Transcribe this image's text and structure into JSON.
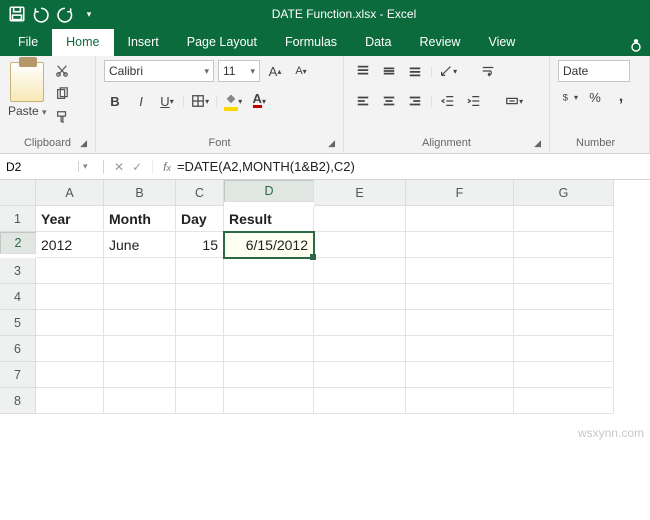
{
  "titlebar": {
    "filename": "DATE Function.xlsx - Excel"
  },
  "tabs": {
    "file": "File",
    "items": [
      "Home",
      "Insert",
      "Page Layout",
      "Formulas",
      "Data",
      "Review",
      "View"
    ],
    "activeIndex": 0
  },
  "ribbon": {
    "clipboard": {
      "paste": "Paste",
      "label": "Clipboard"
    },
    "font": {
      "name": "Calibri",
      "size": "11",
      "label": "Font"
    },
    "alignment": {
      "label": "Alignment"
    },
    "number": {
      "format": "Date",
      "label": "Number"
    }
  },
  "namebox": "D2",
  "formula": "=DATE(A2,MONTH(1&B2),C2)",
  "columns": [
    "A",
    "B",
    "C",
    "D",
    "E",
    "F",
    "G"
  ],
  "rows": [
    "1",
    "2",
    "3",
    "4",
    "5",
    "6",
    "7",
    "8"
  ],
  "headers": {
    "a1": "Year",
    "b1": "Month",
    "c1": "Day",
    "d1": "Result"
  },
  "data": {
    "a2": "2012",
    "b2": "June",
    "c2": "15",
    "d2": "6/15/2012"
  },
  "active": {
    "col": 3,
    "row": 1
  },
  "watermark": "wsxynn.com",
  "chart_data": {
    "type": "table",
    "columns": [
      "Year",
      "Month",
      "Day",
      "Result"
    ],
    "rows": [
      [
        "2012",
        "June",
        15,
        "6/15/2012"
      ]
    ]
  }
}
